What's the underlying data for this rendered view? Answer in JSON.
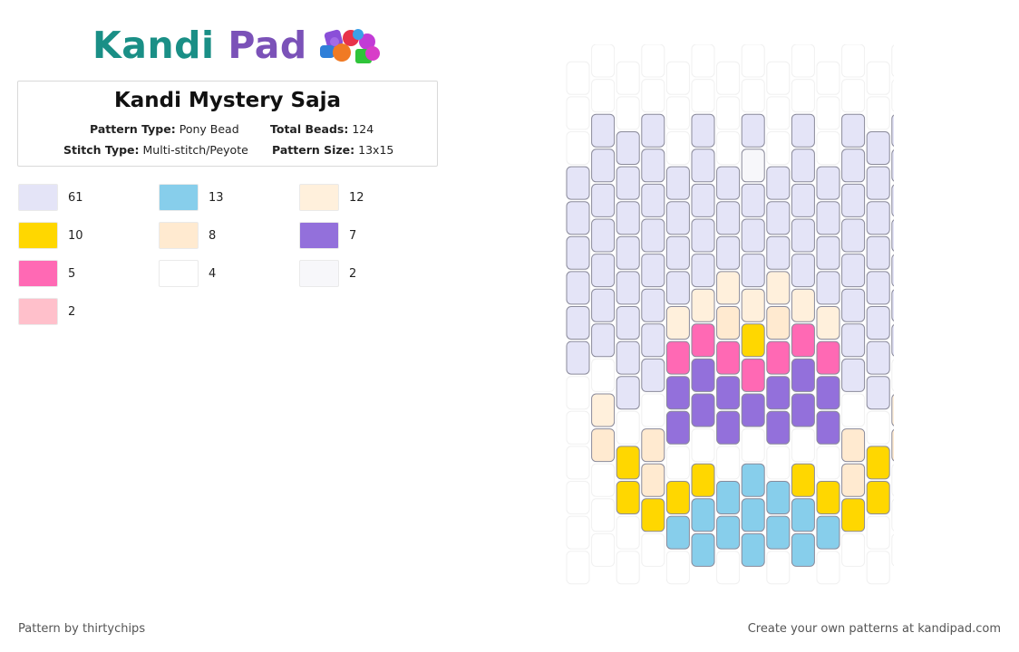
{
  "logo": {
    "text_kandi": "Kandi",
    "text_pad": "Pad",
    "icon": "bead-pile-icon"
  },
  "pattern": {
    "title": "Kandi Mystery Saja",
    "pattern_type_label": "Pattern Type:",
    "pattern_type": "Pony Bead",
    "total_beads_label": "Total Beads:",
    "total_beads": "124",
    "stitch_type_label": "Stitch Type:",
    "stitch_type": "Multi-stitch/Peyote",
    "pattern_size_label": "Pattern Size:",
    "pattern_size": "13x15"
  },
  "palette": [
    {
      "color": "#e4e4f7",
      "count": "61"
    },
    {
      "color": "#87ceeb",
      "count": "13"
    },
    {
      "color": "#fff0dc",
      "count": "12"
    },
    {
      "color": "#ffd700",
      "count": "10"
    },
    {
      "color": "#ffead0",
      "count": "8"
    },
    {
      "color": "#9370db",
      "count": "7"
    },
    {
      "color": "#ff69b4",
      "count": "5"
    },
    {
      "color": "#ffffff",
      "count": "4"
    },
    {
      "color": "#f7f7fa",
      "count": "2"
    },
    {
      "color": "#ffc0cb",
      "count": "2"
    }
  ],
  "bead_grid": {
    "columns": 13,
    "rows": 15,
    "legend": {
      ".": "empty",
      "L": "#e4e4f7",
      "B": "#87ceeb",
      "C": "#fff0dc",
      "Y": "#ffd700",
      "E": "#ffead0",
      "V": "#9370db",
      "H": "#ff69b4",
      "W": "#ffffff",
      "G": "#f7f7fa",
      "P": "#ffc0cb"
    },
    "column_patterns": [
      "...LLLLLL.....",
      "..LLLLLLL.CE..",
      "..LLLLLLLL.YY.",
      "..LLLLLLLL.EEY",
      "...LLLLCHVV.YB",
      "..LLLLLCHVV.YBB",
      "...LLLCEHVV.BB",
      "..LGLLLCYHV.BBB",
      "...LLLCEHVV.BB",
      "..LLLLLCHVV.YBB",
      "...LLLLCHVV.YB",
      "..LLLLLLLL.EEY",
      "..LLLLLLLL.YY.",
      "..LLLLLLL.CE.."
    ]
  },
  "footer": {
    "credit": "Pattern by thirtychips",
    "promo": "Create your own patterns at kandipad.com"
  }
}
